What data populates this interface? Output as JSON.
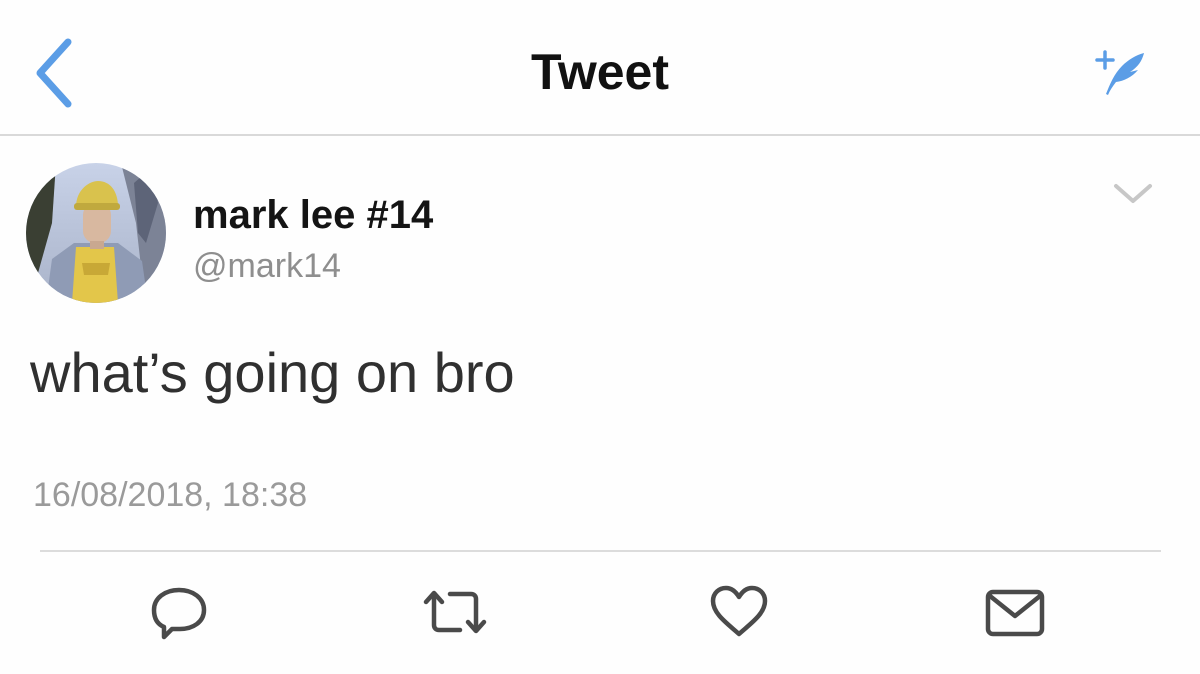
{
  "nav": {
    "title": "Tweet",
    "back_icon": "chevron-left-icon",
    "compose_icon": "compose-quill-icon",
    "accent_color": "#5b9de6"
  },
  "tweet": {
    "display_name": "mark lee #14",
    "handle": "@mark14",
    "text": "what’s going on bro",
    "timestamp": "16/08/2018, 18:38",
    "avatar_icon": "profile-photo-avatar",
    "menu_icon": "chevron-down-icon"
  },
  "actions": [
    {
      "icon": "reply-icon"
    },
    {
      "icon": "retweet-icon"
    },
    {
      "icon": "like-heart-icon"
    },
    {
      "icon": "direct-message-icon"
    }
  ],
  "colors": {
    "icon_gray": "#4a4a4a",
    "caret_gray": "#c7c7c7",
    "divider": "#dcdcdc"
  }
}
